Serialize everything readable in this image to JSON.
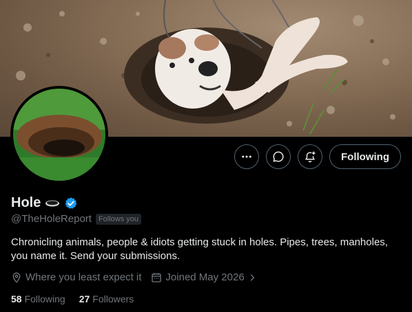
{
  "profile": {
    "name": "Hole",
    "handle": "@TheHoleReport",
    "follows_you_badge": "Follows you",
    "bio": "Chronicling animals, people & idiots getting stuck in holes. Pipes, trees, manholes, you name it. Send your submissions.",
    "location": "Where you least expect it",
    "joined": "Joined May 2026",
    "verified": true
  },
  "actions": {
    "more_icon": "more-horizontal-icon",
    "message_icon": "message-bubble-icon",
    "notify_icon": "bell-plus-icon",
    "following_label": "Following"
  },
  "stats": {
    "following_count": "58",
    "following_label": "Following",
    "followers_count": "27",
    "followers_label": "Followers"
  },
  "colors": {
    "background": "#000000",
    "text_primary": "#e7e9ea",
    "text_secondary": "#71767b",
    "verified_blue": "#1d9bf0",
    "border": "#536471"
  }
}
